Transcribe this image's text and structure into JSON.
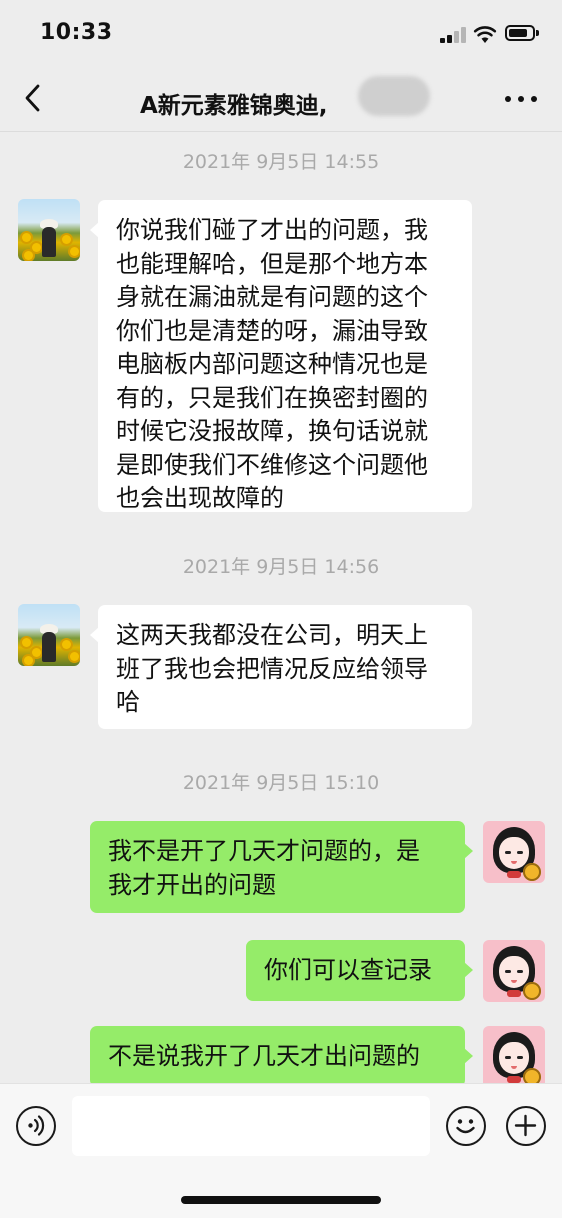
{
  "status_bar": {
    "time": "10:33",
    "icons": [
      "signal-icon",
      "wifi-icon",
      "battery-icon"
    ]
  },
  "nav": {
    "back_icon": "chevron-left-icon",
    "title": "A新元素雅锦奥迪,",
    "more_icon": "more-dots-icon"
  },
  "messages": [
    {
      "type": "timestamp",
      "text": "2021年 9月5日 14:55"
    },
    {
      "type": "received",
      "avatar": "sunflower-avatar",
      "lines": [
        "你说我们碰了才出的问题，我",
        "也能理解哈，但是那个地方本",
        "身就在漏油就是有问题的这个",
        "你们也是清楚的呀，漏油导致",
        "电脑板内部问题这种情况也是",
        "有的，只是我们在换密封圈的",
        "时候它没报故障，换句话说就",
        "是即使我们不维修这个问题他",
        "也会出现故障的"
      ]
    },
    {
      "type": "timestamp",
      "text": "2021年 9月5日 14:56"
    },
    {
      "type": "received",
      "avatar": "sunflower-avatar",
      "lines": [
        "这两天我都没在公司，明天上",
        "班了我也会把情况反应给领导",
        "哈"
      ]
    },
    {
      "type": "timestamp",
      "text": "2021年 9月5日 15:10"
    },
    {
      "type": "sent",
      "avatar": "cartoon-girl-avatar",
      "lines": [
        "我不是开了几天才问题的，是",
        "我才开出的问题"
      ]
    },
    {
      "type": "sent",
      "avatar": "cartoon-girl-avatar",
      "lines": [
        "你们可以查记录"
      ]
    },
    {
      "type": "sent",
      "avatar": "cartoon-girl-avatar",
      "lines": [
        "不是说我开了几天才出问题的"
      ]
    }
  ],
  "input_bar": {
    "voice_icon": "voice-icon",
    "text_value": "",
    "emoji_icon": "emoji-icon",
    "plus_icon": "plus-icon"
  },
  "colors": {
    "background": "#ededed",
    "sent_bubble": "#95ec69",
    "received_bubble": "#ffffff",
    "timestamp_text": "#a9a9a9"
  }
}
